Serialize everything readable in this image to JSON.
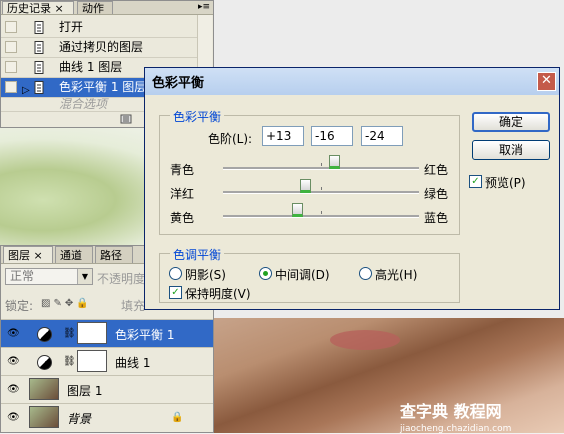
{
  "history_panel": {
    "tabs": [
      "历史记录",
      "动作"
    ],
    "close_glyph": "×",
    "items": [
      {
        "label": "打开"
      },
      {
        "label": "通过拷贝的图层"
      },
      {
        "label": "曲线 1 图层"
      },
      {
        "label": "色彩平衡 1 图层"
      },
      {
        "label": "混合选项"
      }
    ],
    "selected_index": 3
  },
  "layers_panel": {
    "tabs": [
      "图层",
      "通道",
      "路径"
    ],
    "blend_mode": "正常",
    "opacity_label": "不透明度",
    "lock_label": "锁定:",
    "fill_label": "填充",
    "layers": [
      {
        "name": "色彩平衡 1",
        "type": "adjustment",
        "selected": true
      },
      {
        "name": "曲线 1",
        "type": "adjustment",
        "selected": false
      },
      {
        "name": "图层 1",
        "type": "image",
        "selected": false
      },
      {
        "name": "背景",
        "type": "image",
        "locked": true,
        "selected": false
      }
    ]
  },
  "dialog": {
    "title": "色彩平衡",
    "close_glyph": "✕",
    "color_balance_group": "色彩平衡",
    "levels_label": "色阶(L):",
    "levels": [
      "+13",
      "-16",
      "-24"
    ],
    "sliders": [
      {
        "left": "青色",
        "right": "红色",
        "value": 13
      },
      {
        "left": "洋红",
        "right": "绿色",
        "value": -16
      },
      {
        "left": "黄色",
        "right": "蓝色",
        "value": -24
      }
    ],
    "tone_group": "色调平衡",
    "tones": [
      "阴影(S)",
      "中间调(D)",
      "高光(H)"
    ],
    "selected_tone": 1,
    "preserve_luminosity": "保持明度(V)",
    "preserve_checked": true,
    "ok": "确定",
    "cancel": "取消",
    "preview": "预览(P)",
    "preview_checked": true,
    "check_glyph": "✓"
  },
  "watermark": {
    "main": "查字典 教程网",
    "sub": "jiaocheng.chazidian.com"
  }
}
